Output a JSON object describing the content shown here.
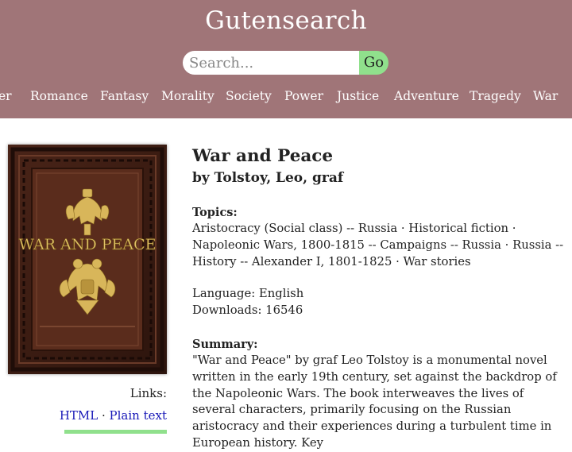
{
  "site": {
    "title": "Gutensearch"
  },
  "search": {
    "placeholder": "Search...",
    "go_label": "Go"
  },
  "nav": {
    "items": [
      {
        "label": "er"
      },
      {
        "label": "Romance"
      },
      {
        "label": "Fantasy"
      },
      {
        "label": "Morality"
      },
      {
        "label": "Society"
      },
      {
        "label": "Power"
      },
      {
        "label": "Justice"
      },
      {
        "label": "Adventure"
      },
      {
        "label": "Tragedy"
      },
      {
        "label": "War"
      }
    ]
  },
  "book": {
    "title": "War and Peace",
    "author": "by Tolstoy, Leo, graf",
    "cover_text": {
      "line": "WAR AND PEACE"
    },
    "topics_label": "Topics:",
    "topics": "Aristocracy (Social class) -- Russia · Historical fiction · Napoleonic Wars, 1800-1815 -- Campaigns -- Russia · Russia -- History -- Alexander I, 1801-1825 · War stories",
    "language": "Language: English",
    "downloads": "Downloads: 16546",
    "summary_label": "Summary:",
    "summary": "\"War and Peace\" by graf Leo Tolstoy is a monumental novel written in the early 19th century, set against the backdrop of the Napoleonic Wars. The book interweaves the lives of several characters, primarily focusing on the Russian aristocracy and their experiences during a turbulent time in European history. Key"
  },
  "links": {
    "label": "Links:",
    "html": "HTML",
    "separator": " · ",
    "plain_text": "Plain text"
  },
  "colors": {
    "header_bg": "#a07578",
    "accent_green": "#90e08c",
    "link_blue": "#1a1ab8"
  }
}
